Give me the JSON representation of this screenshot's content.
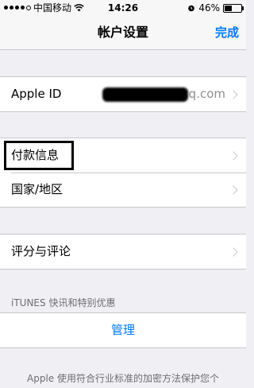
{
  "status_bar": {
    "carrier": "中国移动",
    "time": "14:26",
    "battery": "46%",
    "battery_level": 0.46
  },
  "nav": {
    "title": "帐户设置",
    "done_label": "完成"
  },
  "apple_id": {
    "label": "Apple ID",
    "value_suffix": "q.com"
  },
  "payment": {
    "label": "付款信息"
  },
  "country": {
    "label": "国家/地区"
  },
  "ratings": {
    "label": "评分与评论"
  },
  "itunes": {
    "header": "iTUNES 快讯和特别优惠",
    "manage_label": "管理"
  },
  "footer": {
    "note": "Apple 使用符合行业标准的加密方法保护您个"
  }
}
